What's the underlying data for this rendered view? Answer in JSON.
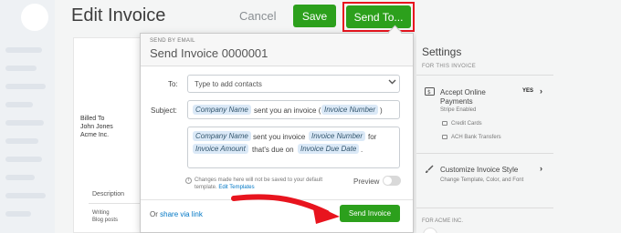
{
  "header": {
    "title": "Edit Invoice",
    "cancel_label": "Cancel",
    "save_label": "Save",
    "send_to_label": "Send To..."
  },
  "invoice": {
    "billed_to_label": "Billed To",
    "billed_name": "John Jones",
    "billed_company": "Acme Inc.",
    "description_header": "Description",
    "item_name": "Writing",
    "item_detail": "Blog posts"
  },
  "email_modal": {
    "send_by_label": "SEND BY EMAIL",
    "title": "Send Invoice 0000001",
    "to_label": "To:",
    "to_placeholder": "Type to add contacts",
    "subject_label": "Subject:",
    "subject_tag1": "Company Name",
    "subject_text1": "sent you an invoice (",
    "subject_tag2": "Invoice Number",
    "subject_text2": ")",
    "body_tag1": "Company Name",
    "body_text1": "sent you invoice",
    "body_tag2": "Invoice Number",
    "body_text2": "for",
    "body_tag3": "Invoice Amount",
    "body_text3": "that's due on",
    "body_tag4": "Invoice Due Date",
    "body_text4": ".",
    "notice_text": "Changes made here will not be saved to your default template.",
    "notice_link": "Edit Templates",
    "preview_label": "Preview",
    "share_prefix": "Or",
    "share_link": "share via link",
    "send_button_label": "Send Invoice"
  },
  "settings": {
    "title": "Settings",
    "section_label": "FOR THIS INVOICE",
    "accept_payments_label": "Accept Online Payments",
    "accept_payments_status": "Stripe Enabled",
    "accept_payments_value": "YES",
    "credit_cards_label": "Credit Cards",
    "ach_label": "ACH Bank Transfers",
    "customize_label": "Customize Invoice Style",
    "customize_sub": "Change Template, Color, and Font",
    "for_company_label": "FOR ACME INC."
  },
  "colors": {
    "accent_green": "#2ca01c",
    "highlight_red": "#e8141e",
    "link_blue": "#0077c5",
    "tag_bg": "#dbe9f7"
  },
  "icons": {
    "info": "info-icon",
    "payments": "dollar-card-icon",
    "style": "brush-icon",
    "chevron": "chevron-right-icon"
  }
}
